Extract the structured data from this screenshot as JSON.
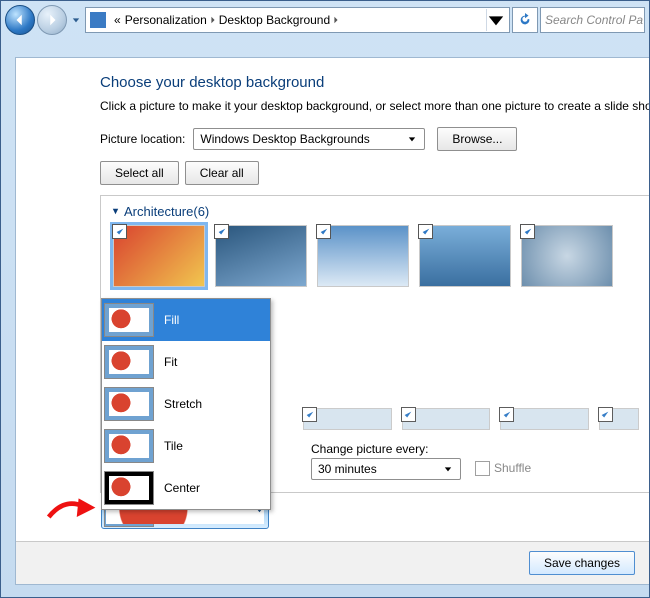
{
  "nav": {
    "breadcrumb_prefix": "«",
    "crumb1": "Personalization",
    "crumb2": "Desktop Background",
    "search_placeholder": "Search Control Pa"
  },
  "page": {
    "title": "Choose your desktop background",
    "instruction": "Click a picture to make it your desktop background, or select more than one picture to create a slide show"
  },
  "location": {
    "label": "Picture location:",
    "value": "Windows Desktop Backgrounds",
    "browse": "Browse..."
  },
  "buttons": {
    "select_all": "Select all",
    "clear_all": "Clear all",
    "save": "Save changes"
  },
  "group": {
    "name": "Architecture",
    "count_suffix": " (6)"
  },
  "change": {
    "label": "Change picture every:",
    "value": "30 minutes",
    "shuffle": "Shuffle"
  },
  "picpos": {
    "current": "Fill",
    "options": [
      "Fill",
      "Fit",
      "Stretch",
      "Tile",
      "Center"
    ]
  }
}
